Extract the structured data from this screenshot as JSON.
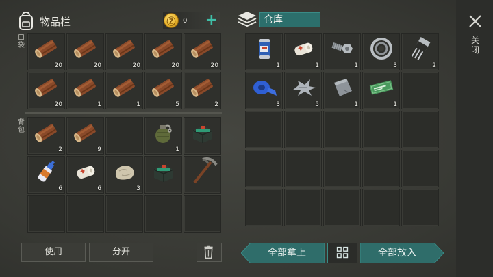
{
  "inventory": {
    "title": "物品栏",
    "coins": "0",
    "pocket_label": "口袋",
    "backpack_label": "背包",
    "pocket_counts": [
      "20",
      "20",
      "20",
      "20",
      "20",
      "20",
      "1",
      "1",
      "5",
      "2"
    ],
    "backpack_counts": [
      "2",
      "9",
      "",
      "1",
      "",
      "6",
      "6",
      "3",
      "",
      ""
    ]
  },
  "storage": {
    "title": "仓库",
    "counts": [
      "1",
      "1",
      "1",
      "3",
      "2",
      "3",
      "5",
      "1",
      "1"
    ]
  },
  "close_label": "关闭",
  "buttons": {
    "use": "使用",
    "split": "分开",
    "take_all": "全部拿上",
    "put_all": "全部放入"
  },
  "colors": {
    "accent": "#3fbfa8",
    "teal_button": "#2f6d6a"
  },
  "icons": [
    "backpack-icon",
    "coin-icon",
    "plus-icon",
    "storage-box-icon",
    "close-icon",
    "trash-icon",
    "grid-icon"
  ]
}
